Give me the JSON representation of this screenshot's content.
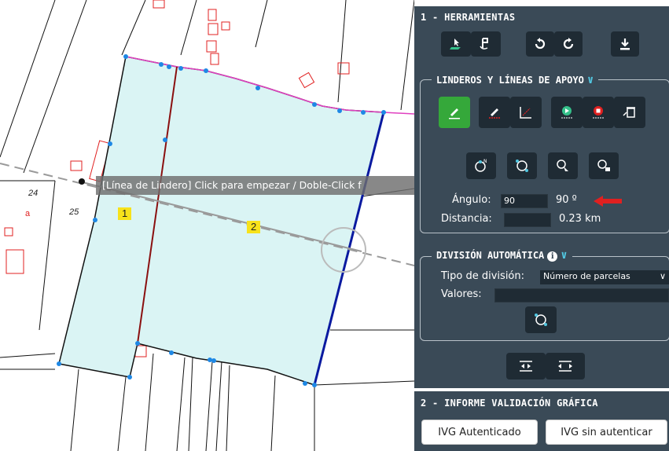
{
  "map": {
    "parcel_labels": [
      "24",
      "25",
      "a"
    ],
    "parcel_badges": [
      "1",
      "2"
    ],
    "tooltip": "[Línea de Lindero] Click para empezar / Doble-Click f"
  },
  "panel": {
    "section1_title": "1 - HERRAMIENTAS",
    "tools": [
      "select-parcel-icon",
      "edit-parcel-icon",
      "undo-icon",
      "redo-icon",
      "download-icon"
    ],
    "linderos": {
      "title": "LINDEROS Y LÍNEAS DE APOYO",
      "buttons": [
        "draw-line-icon",
        "erase-line-icon",
        "xy-line-icon",
        "play-icon",
        "stop-icon",
        "delete-icon"
      ],
      "snap_buttons": [
        "north-rotate-icon",
        "snap-point-icon",
        "zoom-select-icon",
        "zoom-lock-icon"
      ],
      "angle_label": "Ángulo:",
      "angle_input": "90",
      "angle_value": "90 º",
      "distance_label": "Distancia:",
      "distance_input": "",
      "distance_value": "0.23 km",
      "arrow_color": "#e02020"
    },
    "division": {
      "title": "DIVISIÓN AUTOMÁTICA",
      "type_label": "Tipo de división:",
      "type_selected": "Número de parcelas",
      "values_label": "Valores:",
      "values_input": ""
    },
    "section2_title": "2 - INFORME VALIDACIÓN GRÁFICA",
    "ivg_authenticated": "IVG Autenticado",
    "ivg_unauthenticated": "IVG sin autenticar",
    "accent_green": "#35a83a",
    "accent_cyan": "#52c6e0",
    "panel_bg": "#3a4a57"
  }
}
